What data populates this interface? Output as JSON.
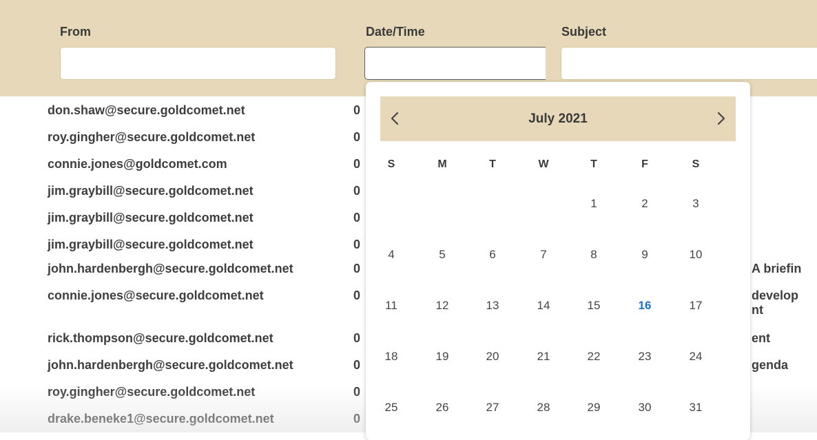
{
  "filters": {
    "from_label": "From",
    "datetime_label": "Date/Time",
    "subject_label": "Subject",
    "from_value": "",
    "datetime_value": "",
    "subject_value": ""
  },
  "messages": [
    {
      "from": "don.shaw@secure.goldcomet.net",
      "date": "0",
      "subject": ""
    },
    {
      "from": "roy.gingher@secure.goldcomet.net",
      "date": "0",
      "subject": ""
    },
    {
      "from": "connie.jones@goldcomet.com",
      "date": "0",
      "subject": ""
    },
    {
      "from": "jim.graybill@secure.goldcomet.net",
      "date": "0",
      "subject": ""
    },
    {
      "from": "jim.graybill@secure.goldcomet.net",
      "date": "0",
      "subject": ""
    },
    {
      "from": "jim.graybill@secure.goldcomet.net",
      "date": "0",
      "subject": ""
    },
    {
      "from": "john.hardenbergh@secure.goldcomet.net",
      "date": "0",
      "subject": "A briefin"
    },
    {
      "from": "connie.jones@secure.goldcomet.net",
      "date": "0",
      "subject": "develop\nnt"
    },
    {
      "from": "rick.thompson@secure.goldcomet.net",
      "date": "0",
      "subject": "ent"
    },
    {
      "from": "john.hardenbergh@secure.goldcomet.net",
      "date": "0",
      "subject": "genda"
    },
    {
      "from": "roy.gingher@secure.goldcomet.net",
      "date": "0",
      "subject": ""
    },
    {
      "from": "drake.beneke1@secure.goldcomet.net",
      "date": "0",
      "subject": ""
    }
  ],
  "calendar": {
    "month_label": "July 2021",
    "prev_icon": "chevron-left-icon",
    "next_icon": "chevron-right-icon",
    "weekdays": [
      "S",
      "M",
      "T",
      "W",
      "T",
      "F",
      "S"
    ],
    "weeks": [
      [
        "",
        "",
        "",
        "",
        "1",
        "2",
        "3"
      ],
      [
        "4",
        "5",
        "6",
        "7",
        "8",
        "9",
        "10"
      ],
      [
        "11",
        "12",
        "13",
        "14",
        "15",
        "16",
        "17"
      ],
      [
        "18",
        "19",
        "20",
        "21",
        "22",
        "23",
        "24"
      ],
      [
        "25",
        "26",
        "27",
        "28",
        "29",
        "30",
        "31"
      ]
    ],
    "today": "16",
    "today_color": "#1a74c9",
    "header_color": "#e6d8b8"
  }
}
